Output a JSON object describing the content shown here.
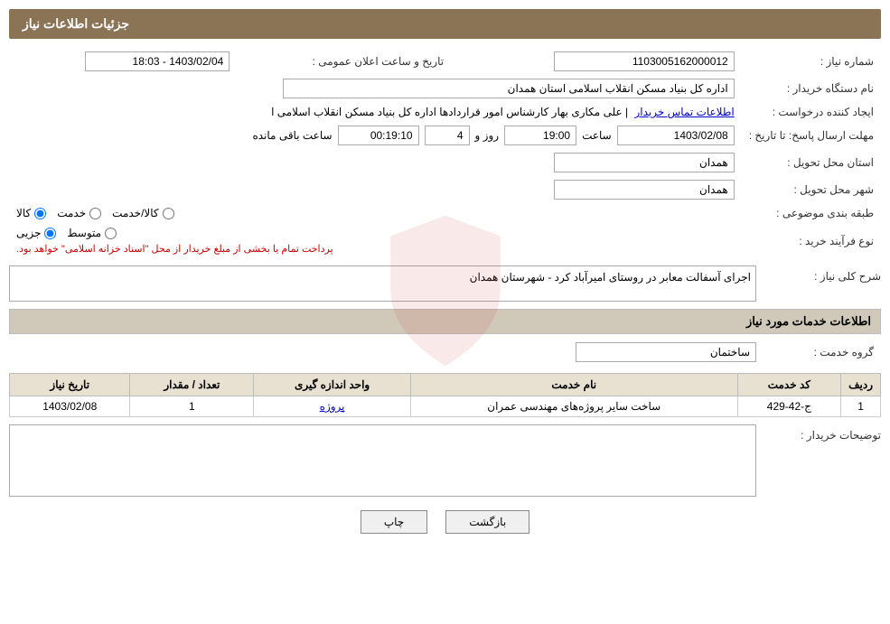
{
  "page": {
    "title": "جزئیات اطلاعات نیاز",
    "header": "جزئیات اطلاعات نیاز"
  },
  "fields": {
    "need_number_label": "شماره نیاز :",
    "need_number_value": "1103005162000012",
    "buyer_label": "نام دستگاه خریدار :",
    "buyer_value": "اداره کل بنیاد مسکن انقلاب اسلامی استان همدان",
    "requester_label": "ایجاد کننده درخواست :",
    "requester_value": "علی مکاری بهار کارشناس امور قراردادها اداره کل بنیاد مسکن انقلاب اسلامی ا",
    "requester_link": "اطلاعات تماس خریدار",
    "deadline_label": "مهلت ارسال پاسخ: تا تاریخ :",
    "date_value": "1403/02/08",
    "time_label": "ساعت",
    "time_value": "19:00",
    "day_label": "روز و",
    "day_value": "4",
    "remaining_label": "ساعت باقی مانده",
    "remaining_value": "00:19:10",
    "province_label": "استان محل تحویل :",
    "province_value": "همدان",
    "city_label": "شهر محل تحویل :",
    "city_value": "همدان",
    "category_label": "طبقه بندی موضوعی :",
    "category_kala": "کالا",
    "category_service": "خدمت",
    "category_kala_service": "کالا/خدمت",
    "process_label": "نوع فرآیند خرید :",
    "process_jozi": "جزیی",
    "process_motavasset": "متوسط",
    "process_note": "پرداخت تمام یا بخشی از مبلغ خریدار از محل \"اسناد خزانه اسلامی\" خواهد بود.",
    "announce_label": "تاریخ و ساعت اعلان عمومی :",
    "announce_value": "1403/02/04 - 18:03",
    "description_label": "شرح کلی نیاز :",
    "description_value": "اجرای آسفالت معابر در روستای امیرآباد کرد - شهرستان همدان",
    "services_section": "اطلاعات خدمات مورد نیاز",
    "service_group_label": "گروه خدمت :",
    "service_group_value": "ساختمان",
    "table_headers": [
      "ردیف",
      "کد خدمت",
      "نام خدمت",
      "واحد اندازه گیری",
      "تعداد / مقدار",
      "تاریخ نیاز"
    ],
    "table_rows": [
      {
        "row": "1",
        "code": "ج-42-429",
        "name": "ساخت سایر پروژه‌های مهندسی عمران",
        "unit": "پروژه",
        "quantity": "1",
        "date": "1403/02/08"
      }
    ],
    "buyer_desc_label": "توضیحات خریدار :",
    "buyer_desc_value": "",
    "btn_print": "چاپ",
    "btn_back": "بازگشت"
  }
}
